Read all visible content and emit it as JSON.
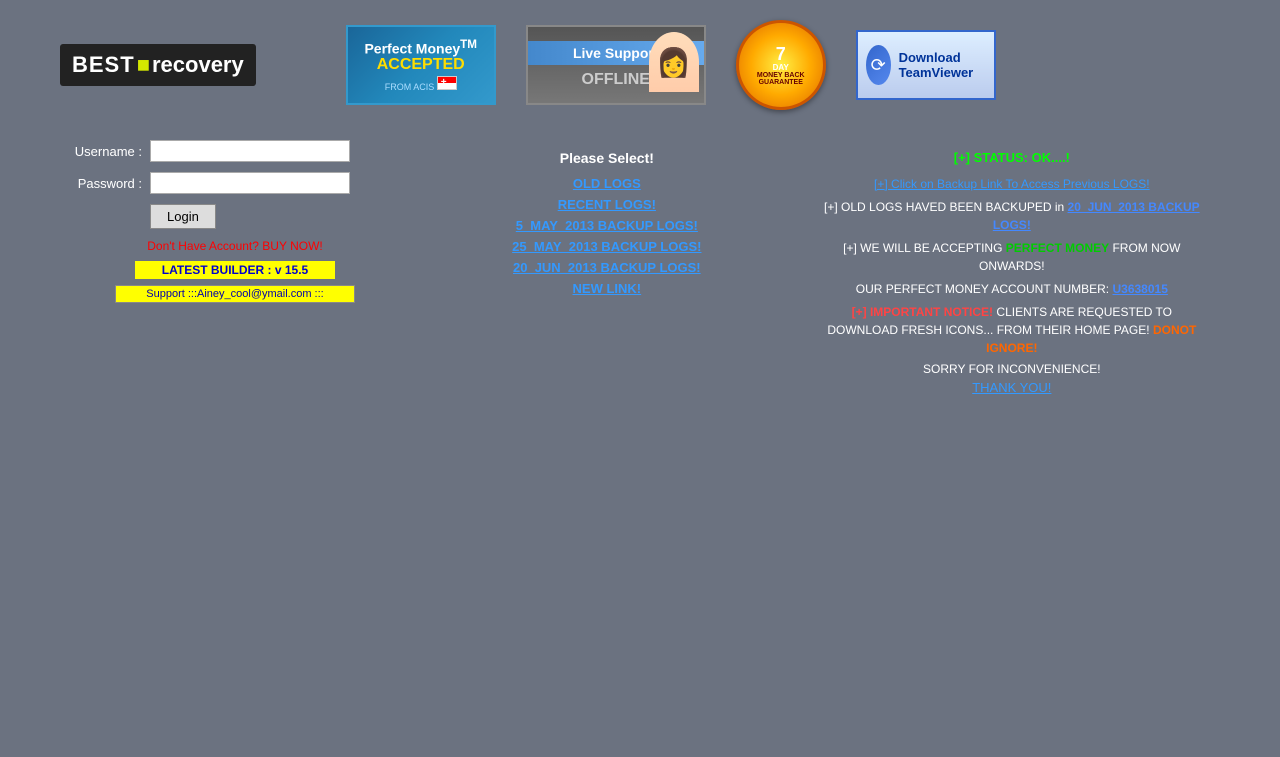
{
  "logo": {
    "best": "BEST",
    "plus": "✦",
    "recovery": "recovery"
  },
  "badges": {
    "perfect_money_title": "Perfect Money",
    "perfect_money_tm": "TM",
    "perfect_money_accepted": "ACCEPTED",
    "perfect_money_sub": "FROM ACIS",
    "live_support_title": "Live Support",
    "live_support_status": "OFFLINE",
    "seven_day_num": "7",
    "seven_day_label": "DAY",
    "seven_day_money": "MONEY BACK",
    "seven_day_guarantee": "GUARANTEE",
    "teamviewer_label": "Download TeamViewer"
  },
  "form": {
    "username_label": "Username :",
    "password_label": "Password :",
    "login_button": "Login"
  },
  "links": {
    "buy_now": "Don't Have Account? BUY NOW!",
    "latest_builder": "LATEST BUILDER : v 15.5",
    "support_email": "Support :::Ainey_cool@ymail.com :::"
  },
  "middle": {
    "please_select": "Please Select!",
    "old_logs": "OLD LOGS",
    "recent_logs": "RECENT LOGS!",
    "backup_5may": "5_MAY_2013 BACKUP LOGS!",
    "backup_25may": "25_MAY_2013 BACKUP LOGS!",
    "backup_20jun": "20_JUN_2013 BACKUP LOGS!",
    "new_link": "NEW LINK!"
  },
  "right": {
    "status": "[+] STATUS: OK....!",
    "backup_notice": "[+] Click on Backup Link To Access Previous LOGS!",
    "old_logs_backed": "[+] OLD LOGS HAVED BEEN BACKUPED in",
    "backup_link_label": "20_JUN_2013 BACKUP LOGS!",
    "perfect_money_notice": "[+] WE WILL BE ACCEPTING",
    "perfect_money_word": "PERFECT MONEY",
    "perfect_money_tail": "FROM  NOW ONWARDS!",
    "account_label": "OUR PERFECT MONEY ACCOUNT NUMBER:",
    "account_number": "U3638015",
    "important_prefix": "[+]",
    "important_word": "IMPORTANT NOTICE!",
    "important_msg": "CLIENTS ARE REQUESTED TO DOWNLOAD FRESH ICONS... FROM THEIR HOME PAGE!",
    "donot_ignore": "DONOT IGNORE!",
    "sorry": "SORRY FOR INCONVENIENCE!",
    "thank_you": "THANK YOU!"
  }
}
